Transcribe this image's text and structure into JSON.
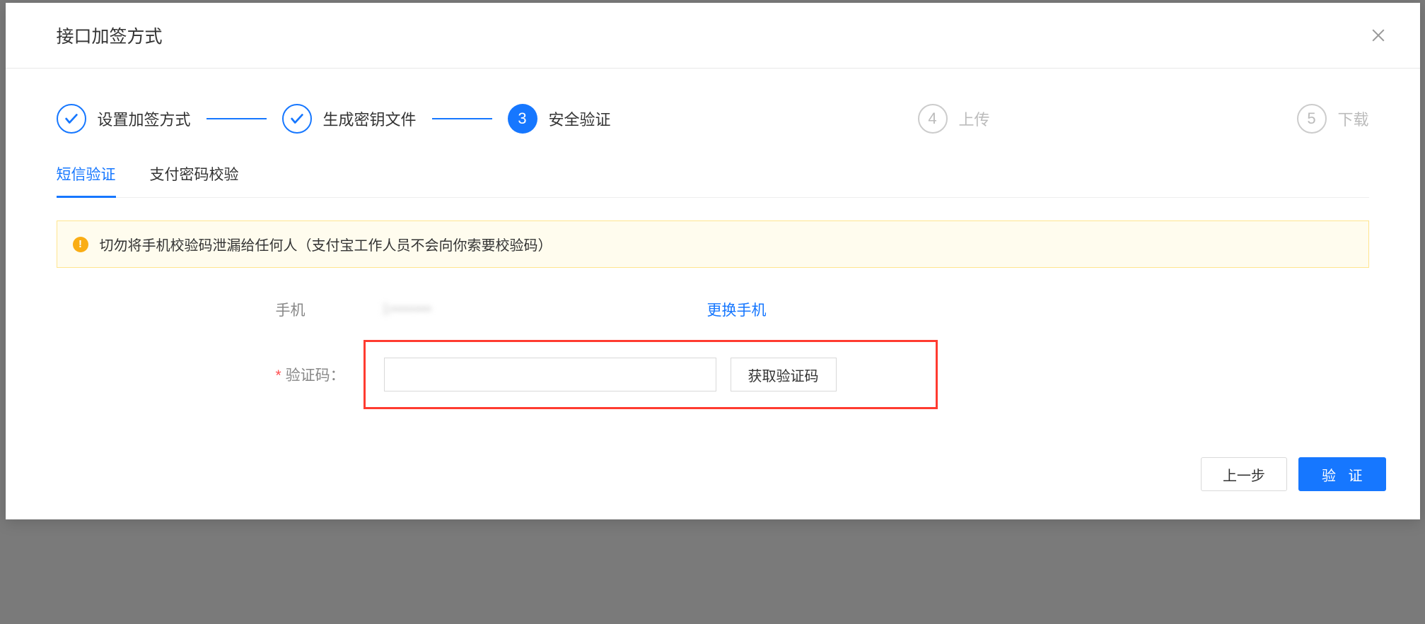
{
  "modal": {
    "title": "接口加签方式"
  },
  "steps": [
    {
      "label": "设置加签方式"
    },
    {
      "label": "生成密钥文件"
    },
    {
      "num": "3",
      "label": "安全验证"
    },
    {
      "num": "4",
      "label": "上传"
    },
    {
      "num": "5",
      "label": "下载"
    }
  ],
  "tabs": {
    "sms": "短信验证",
    "password": "支付密码校验"
  },
  "warning": {
    "text": "切勿将手机校验码泄漏给任何人（支付宝工作人员不会向你索要校验码）"
  },
  "form": {
    "phone_label": "手机",
    "phone_value_masked": "1••••••••",
    "change_phone": "更换手机",
    "code_label": "验证码：",
    "get_code": "获取验证码"
  },
  "footer": {
    "prev": "上一步",
    "verify": "验 证"
  }
}
